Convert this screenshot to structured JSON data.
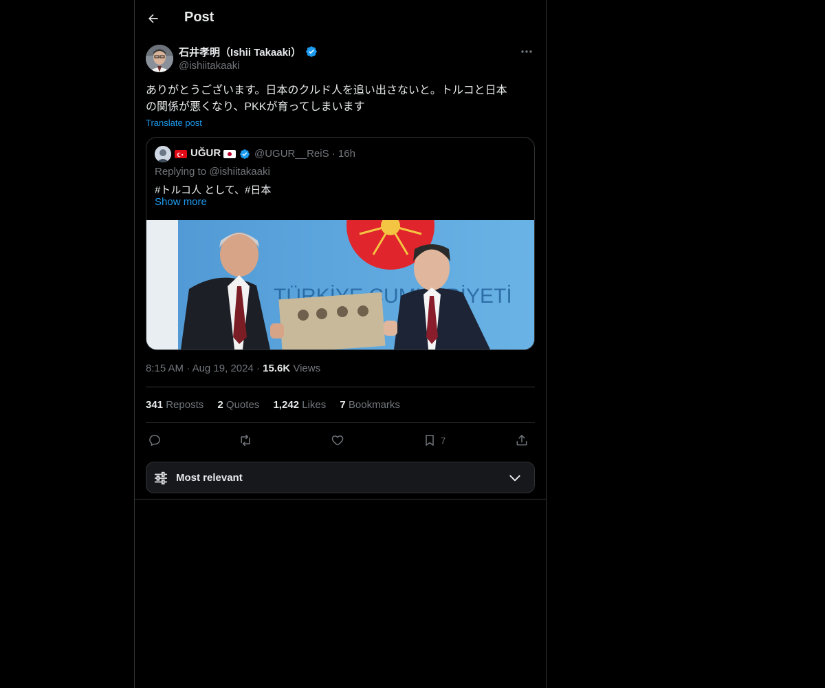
{
  "header": {
    "title": "Post"
  },
  "author": {
    "name": "石井孝明（Ishii Takaaki）",
    "handle": "@ishiitakaaki"
  },
  "post": {
    "text_line1": "ありがとうございます。日本のクルド人を追い出さないと。トルコと日本",
    "text_line2": "の関係が悪くなり、PKKが育ってしまいます",
    "translate": "Translate post"
  },
  "quote": {
    "name": "UĞUR",
    "meta": "@UGUR__ReiS · 16h",
    "replying": "Replying to @ishiitakaaki",
    "text": "#トルコ人 として、#日本",
    "show_more": "Show more",
    "image_text": "TÜRKİYE CUMHURİYETİ"
  },
  "timestamp": {
    "time": "8:15 AM",
    "date": "Aug 19, 2024",
    "views_count": "15.6K",
    "views_label": "Views"
  },
  "stats": {
    "reposts_count": "341",
    "reposts_label": "Reposts",
    "quotes_count": "2",
    "quotes_label": "Quotes",
    "likes_count": "1,242",
    "likes_label": "Likes",
    "bookmarks_count": "7",
    "bookmarks_label": "Bookmarks"
  },
  "actions": {
    "bookmark_count": "7"
  },
  "sort": {
    "label": "Most relevant"
  },
  "colors": {
    "background": "#000000",
    "border": "#2f3336",
    "text": "#e7e9ea",
    "muted": "#71767b",
    "accent": "#1d9bf0"
  }
}
